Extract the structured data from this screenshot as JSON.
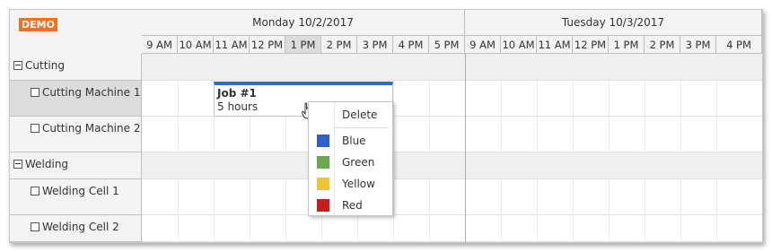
{
  "demo_badge": "DEMO",
  "days": [
    {
      "label": "Monday 10/2/2017"
    },
    {
      "label": "Tuesday 10/3/2017"
    }
  ],
  "hours": [
    "9 AM",
    "10 AM",
    "11 AM",
    "12 PM",
    "1 PM",
    "2 PM",
    "3 PM",
    "4 PM",
    "5 PM",
    "9 AM",
    "10 AM",
    "11 AM",
    "12 PM",
    "1 PM",
    "2 PM",
    "3 PM",
    "4 PM"
  ],
  "highlighted_hour_index": 4,
  "resources": [
    {
      "label": "Cutting",
      "type": "group",
      "expanded": true
    },
    {
      "label": "Cutting Machine 1",
      "type": "item",
      "selected": true
    },
    {
      "label": "Cutting Machine 2",
      "type": "item",
      "selected": false
    },
    {
      "label": "Welding",
      "type": "group",
      "expanded": true
    },
    {
      "label": "Welding Cell 1",
      "type": "item",
      "selected": false
    },
    {
      "label": "Welding Cell 2",
      "type": "item",
      "selected": false
    }
  ],
  "event": {
    "title": "Job #1",
    "duration": "5 hours",
    "color": "#2e6db8"
  },
  "context_menu": {
    "delete_label": "Delete",
    "colors": [
      {
        "label": "Blue",
        "hex": "#2e5fcc"
      },
      {
        "label": "Green",
        "hex": "#6aa84f"
      },
      {
        "label": "Yellow",
        "hex": "#f1c232"
      },
      {
        "label": "Red",
        "hex": "#cc1b1b"
      }
    ]
  }
}
